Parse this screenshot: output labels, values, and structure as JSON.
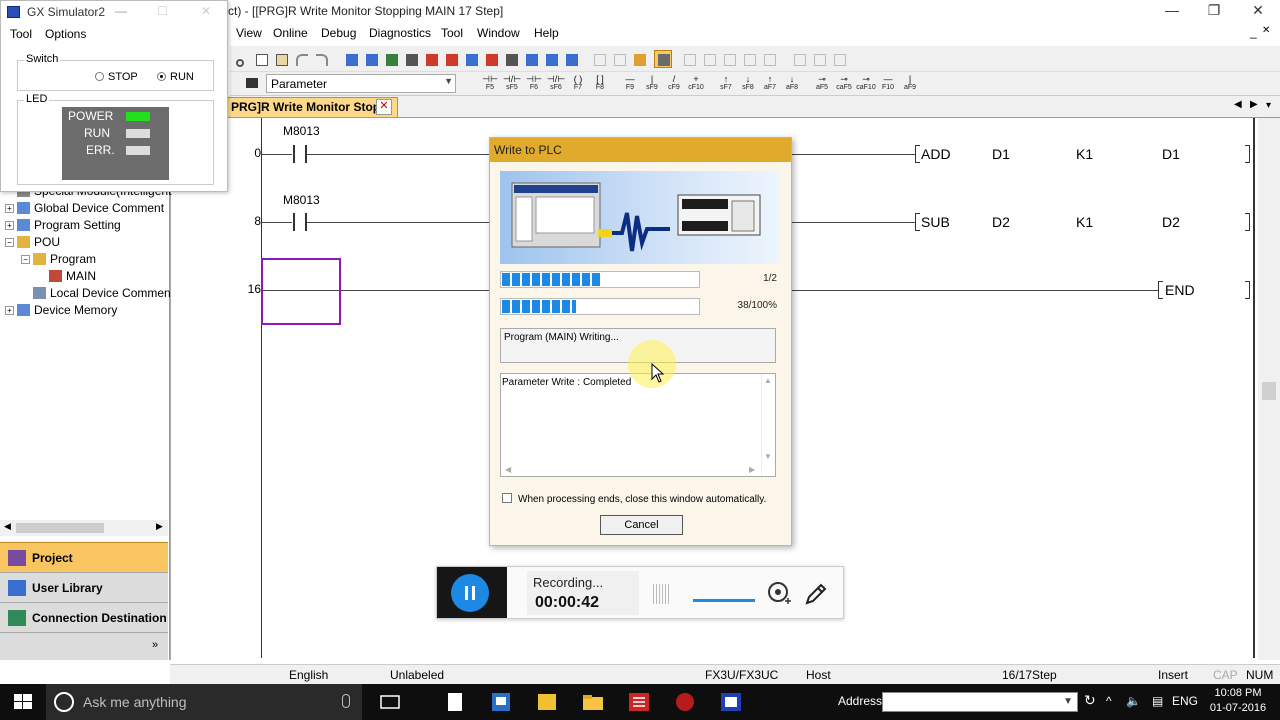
{
  "main_window": {
    "title": "ct) - [[PRG]R Write Monitor Stopping MAIN 17 Step]",
    "controls": {
      "minimize": "—",
      "restore": "❐",
      "close": "✕"
    },
    "mdi_controls": {
      "minimize": "_",
      "restore": "❐",
      "close": "✕"
    }
  },
  "menu": {
    "items": [
      {
        "label": "View",
        "accel": "V"
      },
      {
        "label": "Online",
        "accel": "O"
      },
      {
        "label": "Debug",
        "accel": "b"
      },
      {
        "label": "Diagnostics",
        "accel": "D"
      },
      {
        "label": "Tool",
        "accel": "T"
      },
      {
        "label": "Window",
        "accel": "W"
      },
      {
        "label": "Help",
        "accel": "H"
      }
    ]
  },
  "toolbar": {
    "navigation_combo": "Parameter",
    "fkeys": [
      "F5",
      "sF5",
      "F6",
      "sF6",
      "F7",
      "F8",
      "F9",
      "sF9",
      "cF9",
      "cF10",
      "sF7",
      "sF8",
      "aF7",
      "aF8",
      "aF5",
      "caF5",
      "caF10",
      "F10",
      "aF9"
    ]
  },
  "document_tab": {
    "label": "PRG]R Write Monitor Stop...",
    "close": "✕",
    "nav": {
      "prev": "◀",
      "next": "▶",
      "menu": "▾"
    }
  },
  "ladder": {
    "rungs": [
      {
        "step": "0",
        "contact": "M8013",
        "instruction": "ADD",
        "operands": [
          "D1",
          "K1",
          "D1"
        ]
      },
      {
        "step": "8",
        "contact": "M8013",
        "instruction": "SUB",
        "operands": [
          "D2",
          "K1",
          "D2"
        ]
      },
      {
        "step": "16",
        "contact": "",
        "instruction": "END",
        "operands": []
      }
    ]
  },
  "navigation_tree": {
    "items": [
      {
        "label": "Special Module(Intelligent",
        "level": 0,
        "expander": ""
      },
      {
        "label": "Global Device Comment",
        "level": 0,
        "expander": "+"
      },
      {
        "label": "Program Setting",
        "level": 0,
        "expander": "+"
      },
      {
        "label": "POU",
        "level": 0,
        "expander": "−"
      },
      {
        "label": "Program",
        "level": 1,
        "expander": "−"
      },
      {
        "label": "MAIN",
        "level": 2,
        "expander": ""
      },
      {
        "label": "Local Device Commen",
        "level": 1,
        "expander": ""
      },
      {
        "label": "Device Memory",
        "level": 0,
        "expander": "+"
      }
    ],
    "tabs": [
      {
        "label": "Project",
        "active": true
      },
      {
        "label": "User Library",
        "active": false
      },
      {
        "label": "Connection Destination",
        "active": false
      }
    ],
    "scroll": {
      "left": "◀",
      "right": "▶"
    },
    "expand_more": "»"
  },
  "simulator": {
    "title": "GX Simulator2",
    "menu": [
      "Tool",
      "Options"
    ],
    "switch_group": "Switch",
    "switch_options": [
      {
        "label": "STOP",
        "selected": false
      },
      {
        "label": "RUN",
        "selected": true
      }
    ],
    "led_group": "LED",
    "leds": [
      {
        "label": "POWER",
        "color": "#22e01c"
      },
      {
        "label": "RUN",
        "color": "#dcdcdc"
      },
      {
        "label": "ERR.",
        "color": "#dcdcdc"
      }
    ],
    "controls": {
      "minimize": "—",
      "maximize": "☐",
      "close": "✕"
    }
  },
  "write_dialog": {
    "title": "Write to PLC",
    "overall_progress": {
      "text": "1/2",
      "fraction": 0.5
    },
    "item_progress": {
      "text": "38/100%",
      "fraction": 0.38
    },
    "status": "Program (MAIN) Writing...",
    "log": "Parameter Write : Completed",
    "auto_close_label": "When processing ends, close this window automatically.",
    "auto_close_checked": false,
    "cancel_label": "Cancel",
    "scroll": {
      "up": "▲",
      "down": "▼",
      "left": "◀",
      "right": "▶"
    }
  },
  "recorder": {
    "status": "Recording...",
    "time": "00:00:42"
  },
  "status_bar": {
    "language": "English",
    "label": "Unlabeled",
    "cpu": "FX3U/FX3UC",
    "connection": "Host",
    "step": "16/17Step",
    "insert": "Insert",
    "caps": "CAP",
    "num": "NUM"
  },
  "taskbar": {
    "search_placeholder": "Ask me anything",
    "address_label": "Address",
    "language": "ENG",
    "time": "10:08 PM",
    "date": "01-07-2016"
  }
}
